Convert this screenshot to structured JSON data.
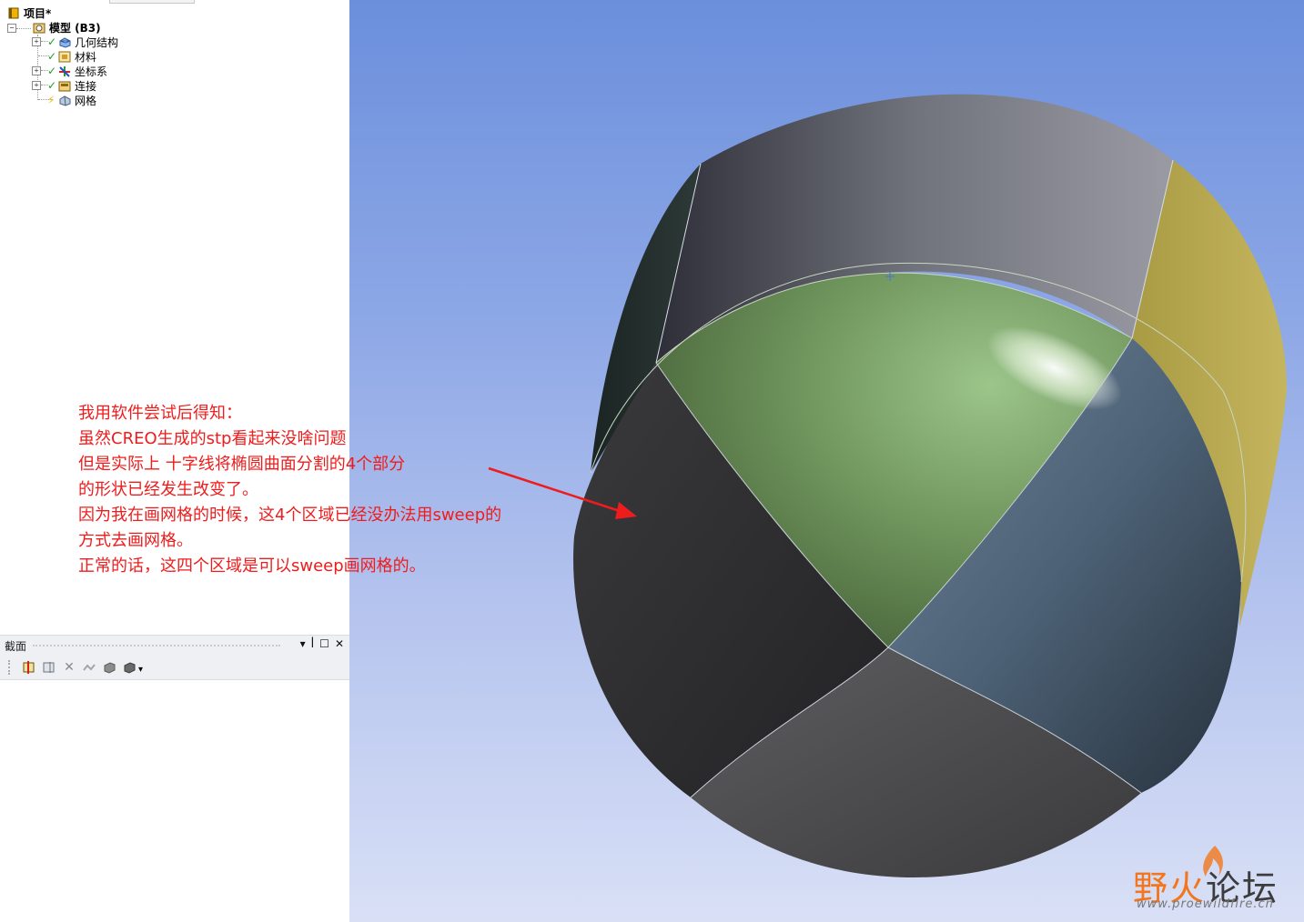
{
  "tree": {
    "project_label": "项目*",
    "model_label": "模型 (B3)",
    "items": [
      {
        "label": "几何结构",
        "expandable": true,
        "status": "check",
        "icon": "geometry-icon"
      },
      {
        "label": "材料",
        "expandable": false,
        "status": "check",
        "icon": "material-icon"
      },
      {
        "label": "坐标系",
        "expandable": true,
        "status": "check",
        "icon": "coordinate-system-icon"
      },
      {
        "label": "连接",
        "expandable": true,
        "status": "check",
        "icon": "connection-icon"
      },
      {
        "label": "网格",
        "expandable": false,
        "status": "lightning",
        "icon": "mesh-icon"
      }
    ]
  },
  "section_panel": {
    "title": "截面",
    "buttons": [
      "chevron-down-icon",
      "pin-icon",
      "maximize-icon",
      "close-icon"
    ]
  },
  "toolbar": {
    "icons": [
      "new-section-plane-icon",
      "section-plane-icon",
      "delete-icon",
      "display-edges-icon",
      "section-fill-icon",
      "cap-icon",
      "dropdown-arrow-icon"
    ]
  },
  "annotation": {
    "lines": [
      "我用软件尝试后得知：",
      "虽然CREO生成的stp看起来没啥问题",
      "但是实际上 十字线将椭圆曲面分割的4个部分",
      "的形状已经发生改变了。",
      "因为我在画网格的时候，这4个区域已经没办法用sweep的",
      "方式去画网格。",
      "正常的话，这四个区域是可以sweep画网格的。"
    ],
    "color": "#ee1c1c"
  },
  "watermark": {
    "text_a": "野火",
    "text_b": "论坛",
    "url": "www.proewildfire.cn"
  },
  "colors": {
    "viewport_top": "#6b8fdc",
    "viewport_bottom": "#d9e0f6",
    "green_region": "#6f9a5e",
    "blue_region": "#5a6f86",
    "yellow_face": "#b8a84e"
  }
}
